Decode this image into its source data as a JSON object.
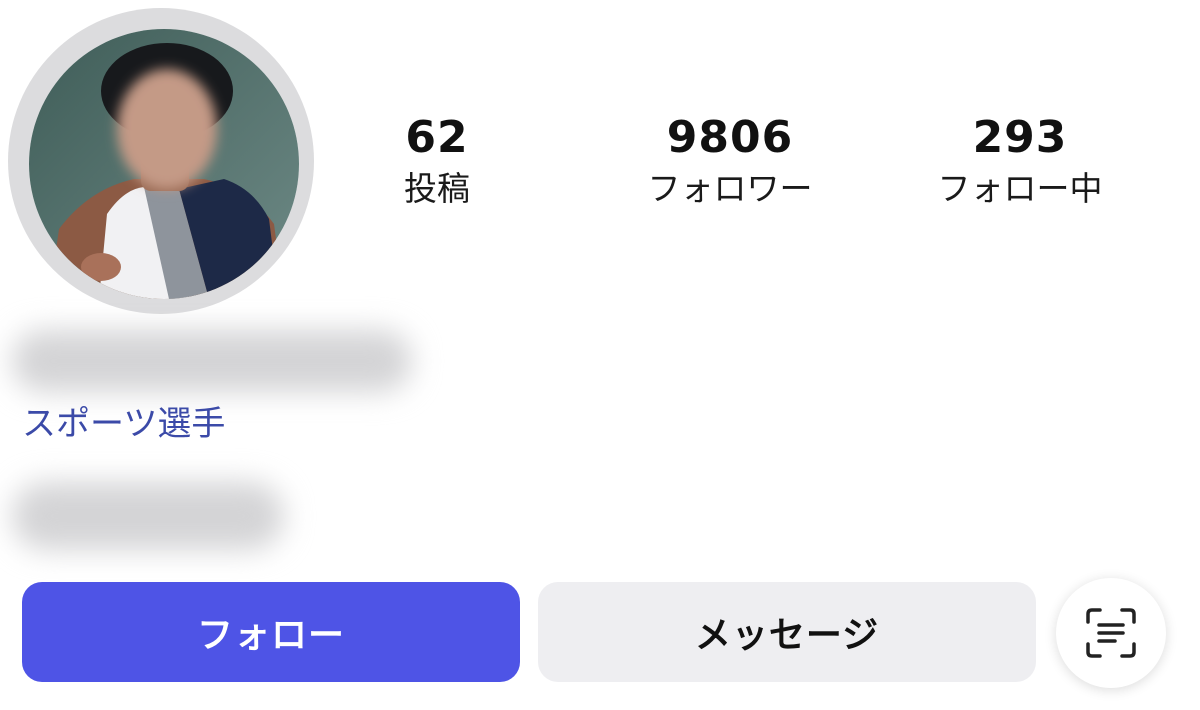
{
  "profile": {
    "avatar_icon": "profile-photo",
    "category": "スポーツ選手"
  },
  "stats": [
    {
      "value": "62",
      "label": "投稿"
    },
    {
      "value": "9806",
      "label": "フォロワー"
    },
    {
      "value": "293",
      "label": "フォロー中"
    }
  ],
  "actions": {
    "follow_label": "フォロー",
    "message_label": "メッセージ",
    "scan_icon": "text-scan-icon"
  },
  "colors": {
    "primary": "#4e54e6",
    "secondary_button": "#eeeef1",
    "category_text": "#3b4aa8"
  }
}
